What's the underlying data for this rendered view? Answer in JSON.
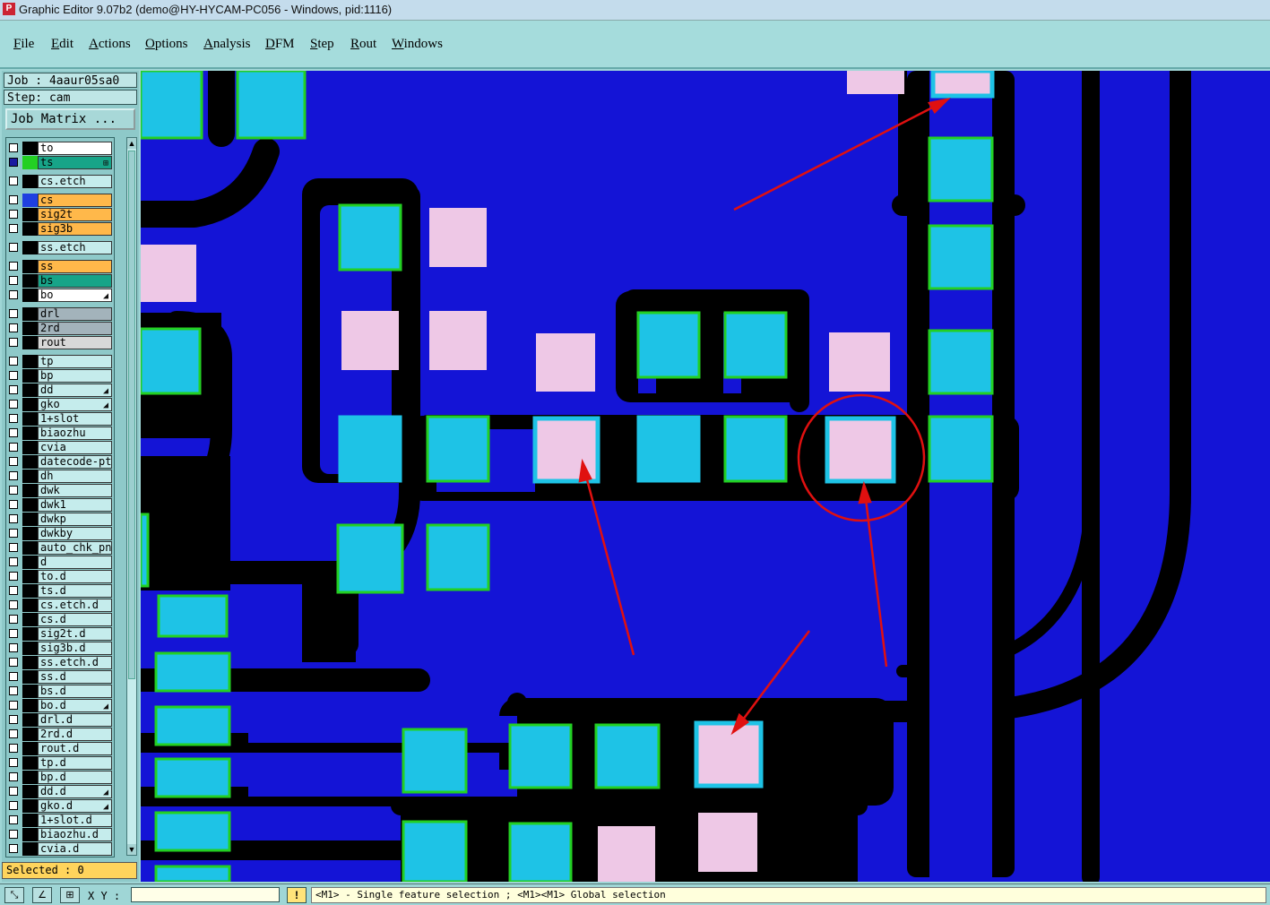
{
  "window": {
    "title": "Graphic Editor 9.07b2 (demo@HY-HYCAM-PC056 - Windows, pid:1116)",
    "icon": "app-icon"
  },
  "menu": [
    "File",
    "Edit",
    "Actions",
    "Options",
    "Analysis",
    "DFM",
    "Step",
    "Rout",
    "Windows"
  ],
  "job": {
    "label": "Job : 4aaur05sa0",
    "step_label": "Step: cam",
    "matrix_button": "Job Matrix ..."
  },
  "layers": [
    {
      "name": "to",
      "color": "#ffffff",
      "swatch": "#000000"
    },
    {
      "name": "ts",
      "color": "#17a488",
      "swatch": "#23d023",
      "active": true,
      "mark": "⊞"
    },
    {
      "name": "cs.etch",
      "color": "#c5ecec",
      "swatch": "#000000",
      "gap": true
    },
    {
      "name": "cs",
      "color": "#ffb84a",
      "swatch": "#1f3fe0",
      "gap": true
    },
    {
      "name": "sig2t",
      "color": "#ffb84a",
      "swatch": "#000000"
    },
    {
      "name": "sig3b",
      "color": "#ffb84a",
      "swatch": "#000000"
    },
    {
      "name": "ss.etch",
      "color": "#c5ecec",
      "swatch": "#000000",
      "gap": true
    },
    {
      "name": "ss",
      "color": "#ffb84a",
      "swatch": "#000000",
      "gap": true
    },
    {
      "name": "bs",
      "color": "#17a488",
      "swatch": "#000000"
    },
    {
      "name": "bo",
      "color": "#ffffff",
      "swatch": "#000000",
      "mark": "◢"
    },
    {
      "name": "drl",
      "color": "#a3b3bb",
      "swatch": "#000000",
      "gap": true
    },
    {
      "name": "2rd",
      "color": "#a3b3bb",
      "swatch": "#000000"
    },
    {
      "name": "rout",
      "color": "#d8d8d8",
      "swatch": "#000000"
    },
    {
      "name": "tp",
      "color": "#c5ecec",
      "swatch": "#000000",
      "gap": true
    },
    {
      "name": "bp",
      "color": "#c5ecec",
      "swatch": "#000000"
    },
    {
      "name": "dd",
      "color": "#c5ecec",
      "swatch": "#000000",
      "mark": "◢"
    },
    {
      "name": "gko",
      "color": "#c5ecec",
      "swatch": "#000000",
      "mark": "◢"
    },
    {
      "name": "1+slot",
      "color": "#c5ecec",
      "swatch": "#000000"
    },
    {
      "name": "biaozhu",
      "color": "#c5ecec",
      "swatch": "#000000"
    },
    {
      "name": "cvia",
      "color": "#c5ecec",
      "swatch": "#000000"
    },
    {
      "name": "datecode-pt",
      "color": "#c5ecec",
      "swatch": "#000000"
    },
    {
      "name": "dh",
      "color": "#c5ecec",
      "swatch": "#000000"
    },
    {
      "name": "dwk",
      "color": "#c5ecec",
      "swatch": "#000000"
    },
    {
      "name": "dwk1",
      "color": "#c5ecec",
      "swatch": "#000000"
    },
    {
      "name": "dwkp",
      "color": "#c5ecec",
      "swatch": "#000000"
    },
    {
      "name": "dwkby",
      "color": "#c5ecec",
      "swatch": "#000000"
    },
    {
      "name": "auto_chk_pn",
      "color": "#c5ecec",
      "swatch": "#000000"
    },
    {
      "name": "d",
      "color": "#c5ecec",
      "swatch": "#000000"
    },
    {
      "name": "to.d",
      "color": "#c5ecec",
      "swatch": "#000000"
    },
    {
      "name": "ts.d",
      "color": "#c5ecec",
      "swatch": "#000000"
    },
    {
      "name": "cs.etch.d",
      "color": "#c5ecec",
      "swatch": "#000000"
    },
    {
      "name": "cs.d",
      "color": "#c5ecec",
      "swatch": "#000000"
    },
    {
      "name": "sig2t.d",
      "color": "#c5ecec",
      "swatch": "#000000"
    },
    {
      "name": "sig3b.d",
      "color": "#c5ecec",
      "swatch": "#000000"
    },
    {
      "name": "ss.etch.d",
      "color": "#c5ecec",
      "swatch": "#000000"
    },
    {
      "name": "ss.d",
      "color": "#c5ecec",
      "swatch": "#000000"
    },
    {
      "name": "bs.d",
      "color": "#c5ecec",
      "swatch": "#000000"
    },
    {
      "name": "bo.d",
      "color": "#c5ecec",
      "swatch": "#000000",
      "mark": "◢"
    },
    {
      "name": "drl.d",
      "color": "#c5ecec",
      "swatch": "#000000"
    },
    {
      "name": "2rd.d",
      "color": "#c5ecec",
      "swatch": "#000000"
    },
    {
      "name": "rout.d",
      "color": "#c5ecec",
      "swatch": "#000000"
    },
    {
      "name": "tp.d",
      "color": "#c5ecec",
      "swatch": "#000000"
    },
    {
      "name": "bp.d",
      "color": "#c5ecec",
      "swatch": "#000000"
    },
    {
      "name": "dd.d",
      "color": "#c5ecec",
      "swatch": "#000000",
      "mark": "◢"
    },
    {
      "name": "gko.d",
      "color": "#c5ecec",
      "swatch": "#000000",
      "mark": "◢"
    },
    {
      "name": "1+slot.d",
      "color": "#c5ecec",
      "swatch": "#000000"
    },
    {
      "name": "biaozhu.d",
      "color": "#c5ecec",
      "swatch": "#000000"
    },
    {
      "name": "cvia.d",
      "color": "#c5ecec",
      "swatch": "#000000"
    }
  ],
  "selected": "Selected : 0",
  "status": {
    "xy_label": "X Y :",
    "xy_value": "",
    "warn": "!",
    "message": "<M1> - Single feature selection ; <M1><M1> Global selection",
    "tool_icons": [
      "zoom-area-icon",
      "measure-icon",
      "snap-grid-icon"
    ]
  },
  "colors": {
    "board": "#1414d6",
    "clearance": "#000000",
    "pad": "#1ec3e6",
    "pad_outline": "#23d023",
    "smd_pink": "#eec8e6",
    "arrow": "#e01010"
  }
}
